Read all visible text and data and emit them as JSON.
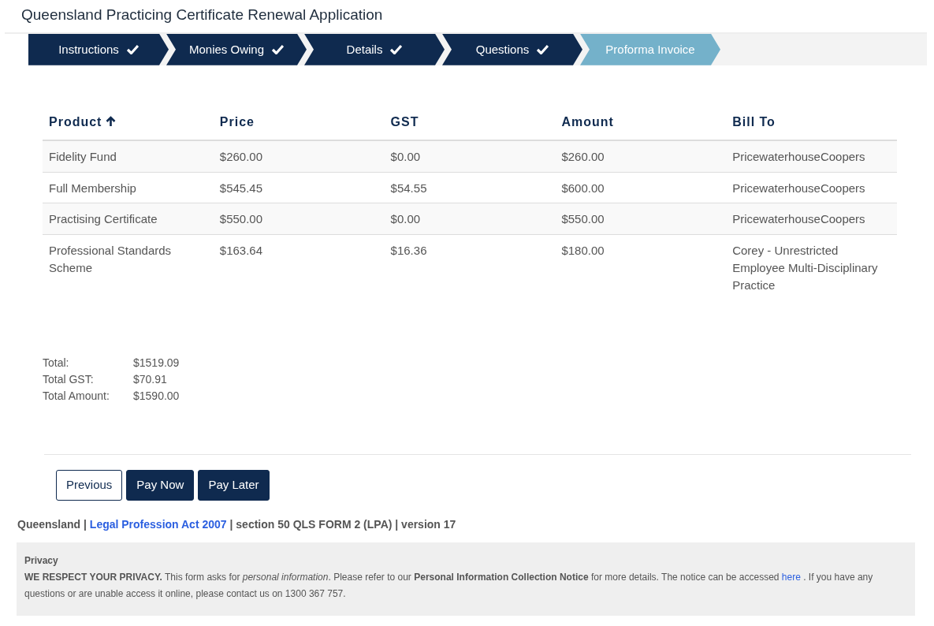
{
  "title": "Queensland Practicing Certificate Renewal Application",
  "steps": [
    {
      "label": "Instructions",
      "done": true,
      "selected": false
    },
    {
      "label": "Monies Owing",
      "done": true,
      "selected": false
    },
    {
      "label": "Details",
      "done": true,
      "selected": false
    },
    {
      "label": "Questions",
      "done": true,
      "selected": false
    },
    {
      "label": "Proforma Invoice",
      "done": false,
      "selected": true
    }
  ],
  "table": {
    "columns": [
      {
        "label": "Product",
        "sorted": true
      },
      {
        "label": "Price",
        "sorted": false
      },
      {
        "label": "GST",
        "sorted": false
      },
      {
        "label": "Amount",
        "sorted": false
      },
      {
        "label": "Bill To",
        "sorted": false
      }
    ],
    "rows": [
      [
        "Fidelity Fund",
        "$260.00",
        "$0.00",
        "$260.00",
        "PricewaterhouseCoopers"
      ],
      [
        "Full Membership",
        "$545.45",
        "$54.55",
        "$600.00",
        "PricewaterhouseCoopers"
      ],
      [
        "Practising Certificate",
        "$550.00",
        "$0.00",
        "$550.00",
        "PricewaterhouseCoopers"
      ],
      [
        "Professional Standards Scheme",
        "$163.64",
        "$16.36",
        "$180.00",
        "Corey - Unrestricted Employee Multi-Disciplinary Practice"
      ]
    ]
  },
  "totals": [
    {
      "label": "Total:",
      "value": "$1519.09"
    },
    {
      "label": "Total GST:",
      "value": "$70.91"
    },
    {
      "label": "Total Amount:",
      "value": "$1590.00"
    }
  ],
  "buttons": [
    {
      "label": "Previous",
      "kind": "outline"
    },
    {
      "label": "Pay Now",
      "kind": "primary"
    },
    {
      "label": "Pay Later",
      "kind": "primary"
    }
  ],
  "form_reference": {
    "before": "Queensland | ",
    "link": "Legal Profession Act 2007",
    "after": " | section 50 QLS FORM 2 (LPA) | version 17"
  },
  "privacy": {
    "title": "Privacy",
    "before": "**WE RESPECT YOUR PRIVACY.** This form asks for *personal information*. Please refer to our **Personal Information Collection Notice** for more details. The notice can be accessed ",
    "link": "here",
    "after": " . If you have any questions or are unable access it online, please contact us on 1300 367 757."
  }
}
